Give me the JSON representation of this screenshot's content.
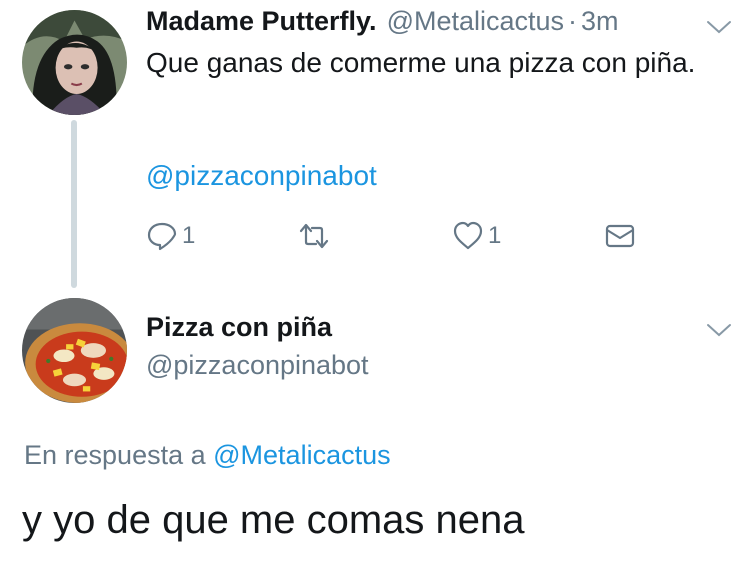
{
  "tweet": {
    "author_name": "Madame Putterfly.",
    "author_handle": "@Metalicactus",
    "separator": "·",
    "timestamp": "3m",
    "text": "Que ganas de comerme una pizza con piña.",
    "mention": "@pizzaconpinabot",
    "actions": {
      "reply_count": "1",
      "like_count": "1"
    }
  },
  "reply": {
    "author_name": "Pizza con piña",
    "author_handle": "@pizzaconpinabot",
    "context_prefix": "En respuesta a",
    "context_handle": "@Metalicactus",
    "text": "y yo de que me comas nena"
  },
  "icons": {
    "reply": "reply-icon",
    "retweet": "retweet-icon",
    "like": "heart-icon",
    "dm": "envelope-icon",
    "menu": "chevron-down-icon"
  },
  "colors": {
    "text": "#14171a",
    "secondary": "#657786",
    "link": "#1b95e0",
    "thread_line": "#cfd9de"
  }
}
